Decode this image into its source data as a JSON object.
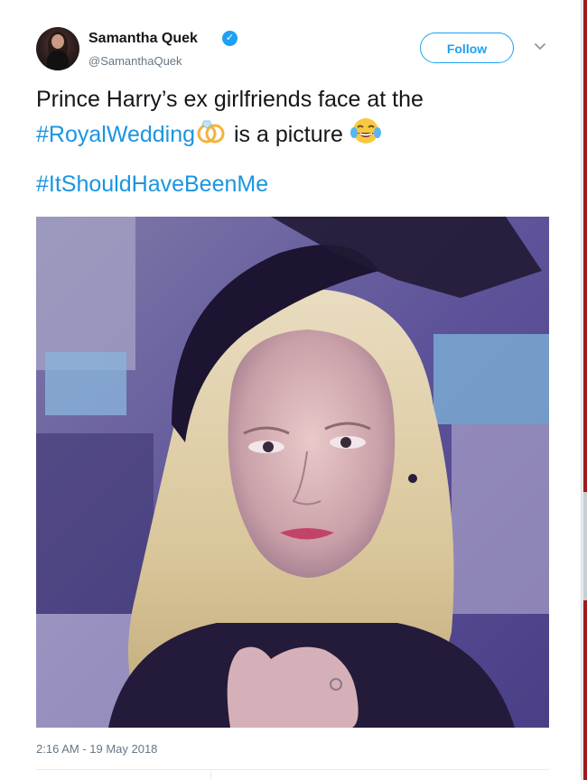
{
  "tweet": {
    "author": {
      "name": "Samantha Quek",
      "handle": "@SamanthaQuek",
      "verified_mark": "✓"
    },
    "follow_label": "Follow",
    "text": {
      "line1": "Prince Harry’s ex girlfriends face at the",
      "hashtag_royal": "#RoyalWedding",
      "after_ring": " is a picture ",
      "hashtag_should": "#ItShouldHaveBeenMe"
    },
    "icons": {
      "ring": "wedding-rings-emoji",
      "laugh": "tears-of-joy-emoji",
      "chevron": "chevron-down-icon"
    },
    "timestamp": "2:16 AM - 19 May 2018"
  },
  "colors": {
    "link": "#1b95e0",
    "follow": "#1da1f2",
    "text": "#14171a",
    "muted": "#657786"
  }
}
